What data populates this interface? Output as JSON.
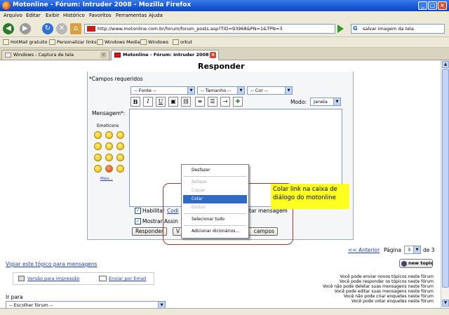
{
  "window": {
    "title": "Motonline - Fórum: Intruder 2008 - Mozilla Firefox"
  },
  "menubar": [
    "Arquivo",
    "Editar",
    "Exibir",
    "Histórico",
    "Favoritos",
    "Ferramentas",
    "Ajuda"
  ],
  "toolbar": {
    "url": "http://www.motonline.com.br/forum/forum_posts.asp?TID=93968&PN=1&TPN=3",
    "search_value": "salvar imagem da tela"
  },
  "bookmarks": [
    "HotMail gratuito",
    "Personalizar links",
    "Windows Media",
    "Windows",
    "orkut"
  ],
  "tabs": [
    {
      "label": "Windows - Captura de tela",
      "active": false
    },
    {
      "label": "Motonline - Fórum: Intruder 2008",
      "active": true
    }
  ],
  "form": {
    "heading": "Responder",
    "required_note": "*Campos requeridos",
    "font_select": "-- Fonte --",
    "size_select": "-- Tamanho --",
    "color_select": "-- Cor --",
    "mode_label": "Modo:",
    "mode_value": "Janela",
    "message_label": "Mensagem*:",
    "emoticons_label": "Emoticons",
    "more_emoticons": "Mais...",
    "enable_prefix": "Habilitar",
    "enable_link": "Codi",
    "enable_suffix": "tar mensagem",
    "show_label": "Mostrar Assin",
    "reply_button": "Responder",
    "preview_fragment": "V",
    "clear_fragment": "campos"
  },
  "context_menu": {
    "undo": "Desfazer",
    "redo": "Refazer",
    "copy_cut": "Copiar",
    "paste": "Colar",
    "delete": "Excluir",
    "select_all": "Selecionar tudo",
    "add_dictionary": "Adicionar dicionários..."
  },
  "annotation": {
    "note": "Colar link na caixa de diálogo do motonline"
  },
  "pagination": {
    "prev_link": "<< Anterior",
    "page_label": "Página",
    "page_value": "3",
    "of_label": "de 3",
    "new_topic": "new topic"
  },
  "watch_topic": "Vigiar este tópico para mensagens",
  "print_version": "Versão para impressão",
  "send_email": "Enviar por Email",
  "jump_to_label": "Ir para",
  "jump_select": "-- Escolher fórum --",
  "permissions": [
    "Você pode enviar novos tópicos neste fórum",
    "Você pode responder os tópicos neste fórum",
    "Você não pode deletar suas mensagens neste fórum",
    "Você pode editar suas mensagens neste fórum",
    "Você não pode criar enquetes neste fórum",
    "Você pode votar enquetes neste fórum"
  ],
  "colors": {
    "titlebar": "#1756d6",
    "highlight": "#316ac5",
    "note_bg": "#ffff22",
    "link": "#1f3fa8"
  },
  "icons": [
    "firefox-icon",
    "back-icon",
    "forward-icon",
    "reload-icon",
    "stop-icon",
    "home-icon",
    "go-icon",
    "google-icon"
  ]
}
